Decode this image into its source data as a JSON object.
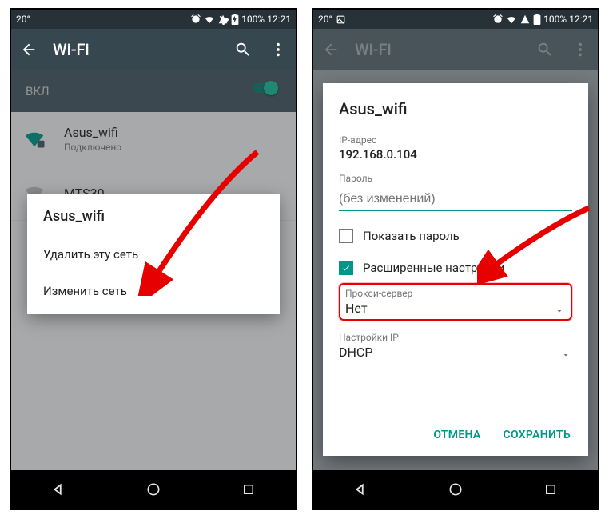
{
  "status": {
    "temp": "20°",
    "battery_pct": "100%",
    "time": "12:21"
  },
  "colors": {
    "accent": "#009688"
  },
  "left": {
    "title": "Wi-Fi",
    "toggle_label": "ВКЛ",
    "networks": [
      {
        "name": "Asus_wifi",
        "status": "Подключено"
      },
      {
        "name": "MTS30",
        "status": ""
      }
    ],
    "context_menu": {
      "title": "Asus_wifi",
      "items": [
        "Удалить эту сеть",
        "Изменить сеть"
      ]
    }
  },
  "right": {
    "title": "Wi-Fi",
    "dialog": {
      "title": "Asus_wifi",
      "ip_label": "IP-адрес",
      "ip_value": "192.168.0.104",
      "password_label": "Пароль",
      "password_placeholder": "(без изменений)",
      "show_password_label": "Показать пароль",
      "show_password_checked": false,
      "advanced_label": "Расширенные настройки",
      "advanced_checked": true,
      "proxy_label": "Прокси-сервер",
      "proxy_value": "Нет",
      "ip_settings_label": "Настройки IP",
      "ip_settings_value": "DHCP",
      "cancel": "ОТМЕНА",
      "save": "СОХРАНИТЬ"
    }
  }
}
